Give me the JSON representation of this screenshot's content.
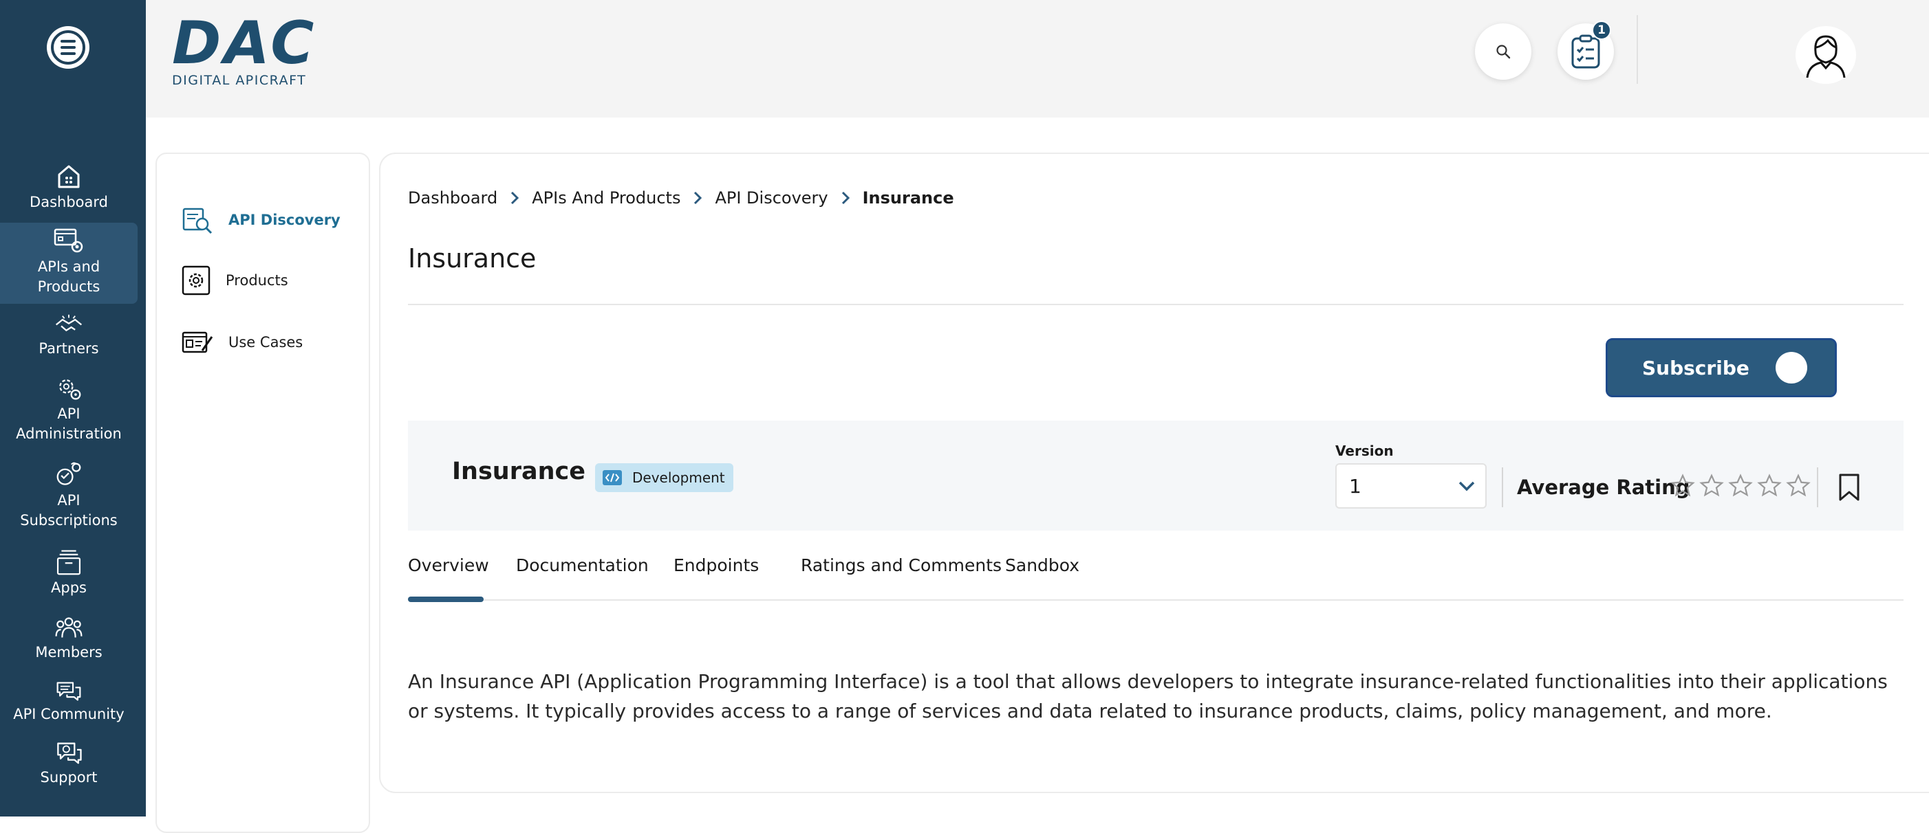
{
  "sidebar": {
    "items": [
      {
        "label": "Dashboard",
        "icon": "dashboard-icon"
      },
      {
        "label": "APIs and Products",
        "icon": "apis-products-icon"
      },
      {
        "label": "Partners",
        "icon": "partners-icon"
      },
      {
        "label": "API Administration",
        "icon": "api-admin-icon"
      },
      {
        "label": "API Subscriptions",
        "icon": "api-subscriptions-icon"
      },
      {
        "label": "Apps",
        "icon": "apps-icon"
      },
      {
        "label": "Members",
        "icon": "members-icon"
      },
      {
        "label": "API Community",
        "icon": "api-community-icon"
      },
      {
        "label": "Support",
        "icon": "support-icon"
      }
    ],
    "active": "APIs and Products"
  },
  "header": {
    "logo_text": "DAC",
    "logo_subtitle": "DIGITAL APICRAFT",
    "tasks_badge": "1"
  },
  "subnav": {
    "items": [
      {
        "label": "API Discovery",
        "icon": "api-discovery-icon"
      },
      {
        "label": "Products",
        "icon": "products-icon"
      },
      {
        "label": "Use Cases",
        "icon": "use-cases-icon"
      }
    ],
    "active": "API Discovery"
  },
  "breadcrumb": [
    "Dashboard",
    "APIs And Products",
    "API Discovery",
    "Insurance"
  ],
  "page_title": "Insurance",
  "subscribe_label": "Subscribe",
  "api": {
    "name": "Insurance",
    "environment": "Development",
    "version_label": "Version",
    "version_value": "1",
    "rating_label": "Average Rating",
    "rating": 0,
    "rating_max": 5
  },
  "tabs": [
    "Overview",
    "Documentation",
    "Endpoints",
    "Ratings and Comments",
    "Sandbox"
  ],
  "active_tab": "Overview",
  "overview_text": "An Insurance API (Application Programming Interface) is a tool that allows developers to integrate insurance-related functionalities into their applications or systems. It typically provides access to a range of services and data related to insurance products, claims, policy management, and more.",
  "colors": {
    "sidebar_bg": "#1f4058",
    "accent": "#2b5a7e",
    "active_link": "#1f6e93",
    "tag_bg": "#c6e4f3"
  }
}
